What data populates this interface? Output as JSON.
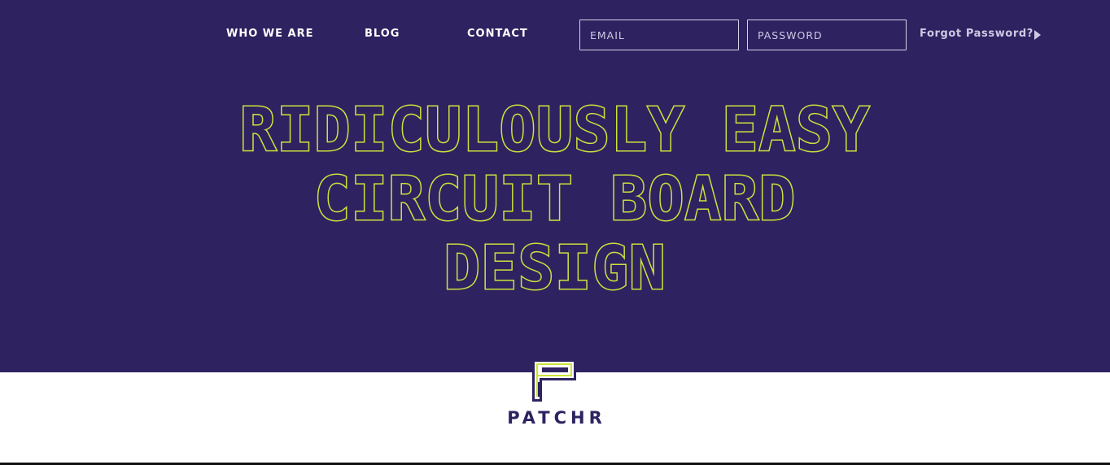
{
  "nav": {
    "who_we_are": "WHO WE ARE",
    "blog": "BLOG",
    "contact": "CONTACT"
  },
  "login": {
    "email_placeholder": "EMAIL",
    "password_placeholder": "PASSWORD",
    "forgot_label": "Forgot Password?",
    "submit_icon": "triangle-right-icon"
  },
  "hero": {
    "headline_lines": [
      "RIDICULOUSLY EASY",
      "CIRCUIT BOARD",
      "DESIGN"
    ]
  },
  "brand": {
    "name": "PATCHR",
    "logo_icon": "patchr-p-logo-icon"
  },
  "colors": {
    "hero_background": "#2e2260",
    "headline_outline": "#cde13c",
    "brand_text": "#2e2260",
    "page_background": "#ffffff"
  }
}
